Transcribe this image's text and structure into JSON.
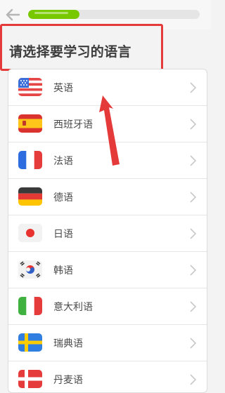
{
  "header": {
    "back_icon": "arrow-left-icon",
    "progress": 0.3
  },
  "title": "请选择要学习的语言",
  "languages": [
    {
      "label": "英语",
      "flag": "us-flag-icon"
    },
    {
      "label": "西班牙语",
      "flag": "spain-flag-icon"
    },
    {
      "label": "法语",
      "flag": "france-flag-icon"
    },
    {
      "label": "德语",
      "flag": "germany-flag-icon"
    },
    {
      "label": "日语",
      "flag": "japan-flag-icon"
    },
    {
      "label": "韩语",
      "flag": "korea-flag-icon"
    },
    {
      "label": "意大利语",
      "flag": "italy-flag-icon"
    },
    {
      "label": "瑞典语",
      "flag": "sweden-flag-icon"
    },
    {
      "label": "丹麦语",
      "flag": "denmark-flag-icon"
    }
  ],
  "colors": {
    "progress": "#78c800",
    "annotation": "#e53a3a"
  }
}
